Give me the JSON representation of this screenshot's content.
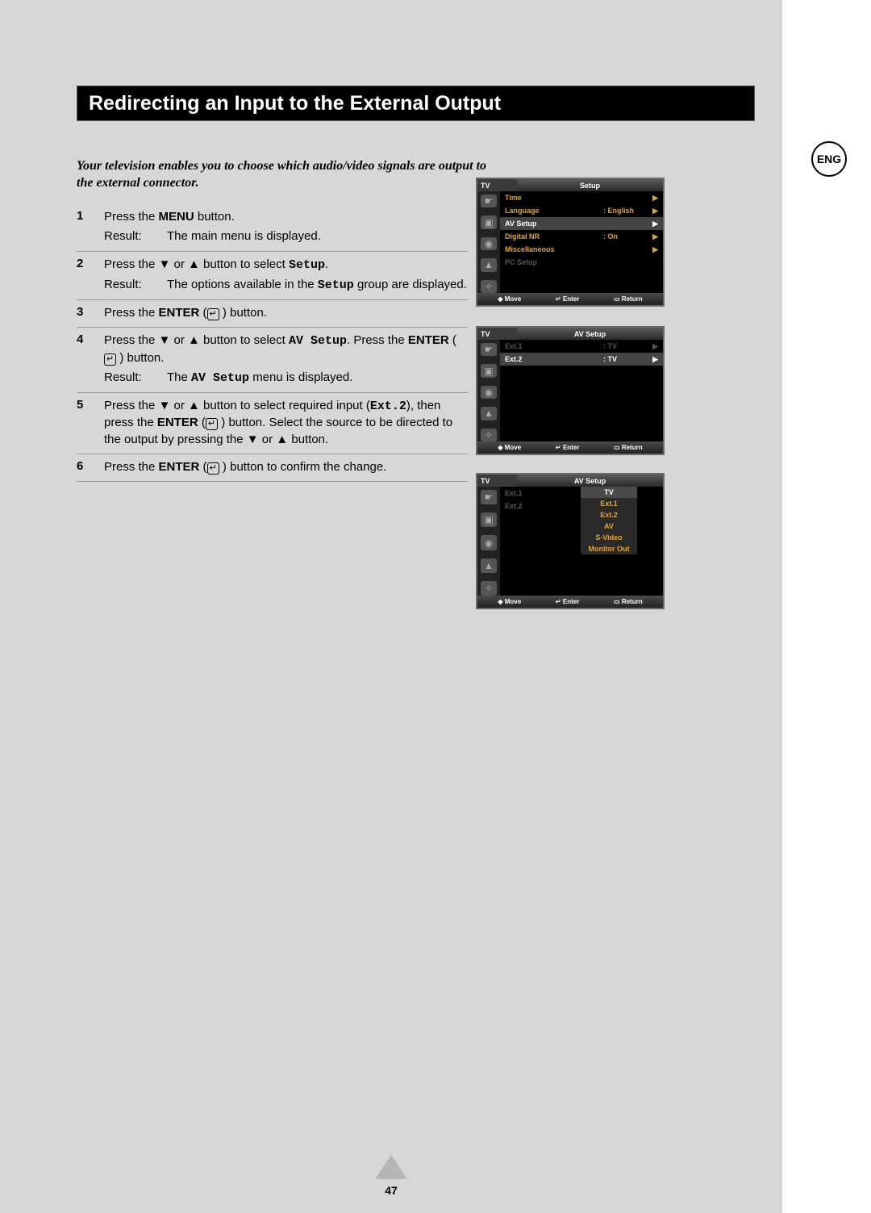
{
  "language_badge": "ENG",
  "heading": "Redirecting an Input to the External Output",
  "intro": "Your television enables you to choose which audio/video signals are output to the external connector.",
  "steps": [
    {
      "num": "1",
      "text_pre": "Press the ",
      "bold1": "MENU",
      "text_post": " button.",
      "result": "The main menu is displayed."
    },
    {
      "num": "2",
      "text_pre": "Press the ▼ or ▲ button to select ",
      "mono1": "Setup",
      "text_post": ".",
      "result_pre": "The options available in the ",
      "result_mono": "Setup",
      "result_post": " group are displayed."
    },
    {
      "num": "3",
      "text_pre": "Press the ",
      "bold1": "ENTER",
      "text_post": " button.",
      "has_enter_icon": true
    },
    {
      "num": "4",
      "text_pre": "Press the ▼ or ▲ button to select ",
      "mono1": "AV Setup",
      "text_mid": ". Press the ",
      "bold1": "ENTER",
      "text_post": " button.",
      "has_enter_icon": true,
      "result_pre": "The ",
      "result_mono": "AV Setup",
      "result_post": " menu is displayed."
    },
    {
      "num": "5",
      "text_pre": "Press the ▼ or ▲ button to select required input (",
      "mono1": "Ext.2",
      "text_mid": "), then press the ",
      "bold1": "ENTER",
      "text_post2": " button. Select the source to be directed to the output by  pressing the ▼ or ▲ button.",
      "has_enter_icon": true
    },
    {
      "num": "6",
      "text_pre": "Press the ",
      "bold1": "ENTER",
      "text_post": " button to confirm the change.",
      "has_enter_icon": true
    }
  ],
  "result_label": "Result:",
  "enter_glyph": "↵",
  "osd": {
    "tv_label": "TV",
    "footer": {
      "move": "Move",
      "enter": "Enter",
      "return": "Return",
      "move_icon": "◆",
      "enter_icon": "↵",
      "return_icon": "▭"
    },
    "menu1": {
      "title": "Setup",
      "rows": [
        {
          "label": "Time",
          "value": "",
          "type": "amber"
        },
        {
          "label": "Language",
          "value": ": English",
          "type": "amber"
        },
        {
          "label": "AV Setup",
          "value": "",
          "type": "highlight"
        },
        {
          "label": "Digital NR",
          "value": ": On",
          "type": "amber"
        },
        {
          "label": "Miscellaneous",
          "value": "",
          "type": "amber"
        },
        {
          "label": "PC Setup",
          "value": "",
          "type": "dim"
        }
      ]
    },
    "menu2": {
      "title": "AV Setup",
      "rows": [
        {
          "label": "Ext.1",
          "value": ": TV",
          "type": "dim"
        },
        {
          "label": "Ext.2",
          "value": ": TV",
          "type": "highlight"
        }
      ]
    },
    "menu3": {
      "title": "AV Setup",
      "rows": [
        {
          "label": "Ext.1",
          "value": ":",
          "type": "dim"
        },
        {
          "label": "Ext.2",
          "value": ":",
          "type": "dim"
        }
      ],
      "options": [
        "TV",
        "Ext.1",
        "Ext.2",
        "AV",
        "S-Video",
        "Monitor Out"
      ],
      "selected": 0
    }
  },
  "page_number": "47"
}
